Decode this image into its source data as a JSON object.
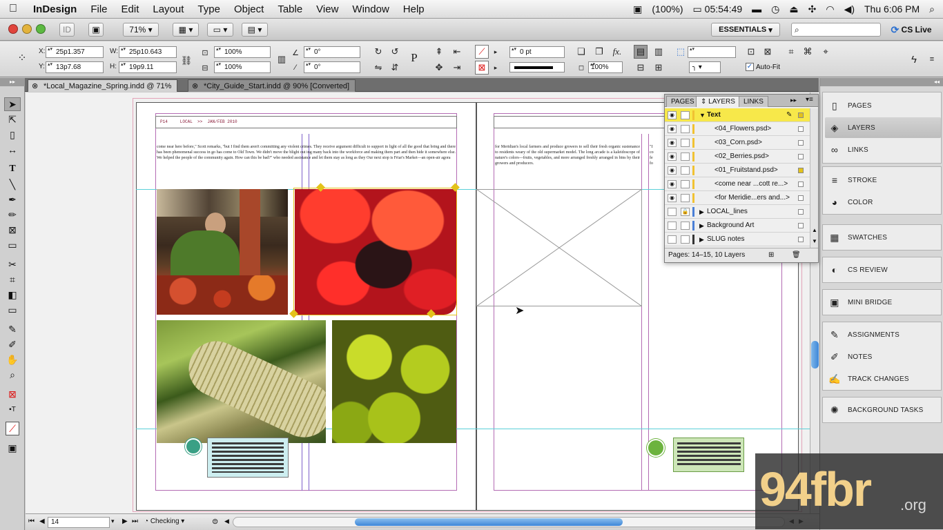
{
  "menubar": {
    "app": "InDesign",
    "menus": [
      "File",
      "Edit",
      "Layout",
      "Type",
      "Object",
      "Table",
      "View",
      "Window",
      "Help"
    ],
    "battery": "(100%)",
    "clock_timer": "05:54:49",
    "datetime": "Thu 6:06 PM"
  },
  "appbar": {
    "zoom": "71%",
    "workspace": "ESSENTIALS",
    "search_placeholder": "",
    "cslive": "CS Live"
  },
  "control": {
    "x_label": "X:",
    "x_value": "25p1.357",
    "y_label": "Y:",
    "y_value": "13p7.68",
    "w_label": "W:",
    "w_value": "25p10.643",
    "h_label": "H:",
    "h_value": "19p9.11",
    "scale_x": "100%",
    "scale_y": "100%",
    "rotate": "0°",
    "shear": "0°",
    "stroke_weight": "0 pt",
    "opacity": "100%",
    "autofit_label": "Auto-Fit"
  },
  "tabs": [
    {
      "label": "*Local_Magazine_Spring.indd @ 71%",
      "active": true
    },
    {
      "label": "*City_Guide_Start.indd @ 90% [Converted]",
      "active": false
    }
  ],
  "layers_panel": {
    "tabs": [
      "PAGES",
      "LAYERS",
      "LINKS"
    ],
    "active_tab": "LAYERS",
    "rows": [
      {
        "name": "Text",
        "level": 0,
        "expanded": true,
        "selected": true,
        "color": "#f1c232"
      },
      {
        "name": "<04_Flowers.psd>",
        "level": 1,
        "color": "#f1c232"
      },
      {
        "name": "<03_Corn.psd>",
        "level": 1,
        "color": "#f1c232"
      },
      {
        "name": "<02_Berries.psd>",
        "level": 1,
        "color": "#f1c232"
      },
      {
        "name": "<01_Fruitstand.psd>",
        "level": 1,
        "color": "#f1c232"
      },
      {
        "name": "<come near ...cott re...>",
        "level": 1,
        "color": "#f1c232"
      },
      {
        "name": "<for Meridie...ers and...>",
        "level": 1,
        "color": "#f1c232"
      },
      {
        "name": "LOCAL_lines",
        "level": 0,
        "locked": true,
        "color": "#4a7fd6"
      },
      {
        "name": "Background Art",
        "level": 0,
        "color": "#4a7fd6"
      },
      {
        "name": "SLUG notes",
        "level": 0,
        "color": "#333333"
      }
    ],
    "footer": "Pages: 14–15, 10 Layers"
  },
  "dock": [
    {
      "group": 1,
      "items": [
        {
          "label": "PAGES",
          "icon": "pages-icon",
          "glyph": "▯"
        },
        {
          "label": "LAYERS",
          "icon": "layers-icon",
          "glyph": "◈",
          "selected": true
        },
        {
          "label": "LINKS",
          "icon": "links-icon",
          "glyph": "∞"
        }
      ]
    },
    {
      "group": 2,
      "items": [
        {
          "label": "STROKE",
          "icon": "stroke-icon",
          "glyph": "≡"
        },
        {
          "label": "COLOR",
          "icon": "color-icon",
          "glyph": "◕"
        }
      ]
    },
    {
      "group": 3,
      "items": [
        {
          "label": "SWATCHES",
          "icon": "swatches-icon",
          "glyph": "▦"
        }
      ]
    },
    {
      "group": 4,
      "items": [
        {
          "label": "CS REVIEW",
          "icon": "cs-review-icon",
          "glyph": "◐"
        }
      ]
    },
    {
      "group": 5,
      "items": [
        {
          "label": "MINI BRIDGE",
          "icon": "mini-bridge-icon",
          "glyph": "▣"
        }
      ]
    },
    {
      "group": 6,
      "items": [
        {
          "label": "ASSIGNMENTS",
          "icon": "assignments-icon",
          "glyph": "✎"
        },
        {
          "label": "NOTES",
          "icon": "notes-icon",
          "glyph": "✐"
        },
        {
          "label": "TRACK CHANGES",
          "icon": "track-changes-icon",
          "glyph": "✍"
        }
      ]
    },
    {
      "group": 7,
      "items": [
        {
          "label": "BACKGROUND TASKS",
          "icon": "background-tasks-icon",
          "glyph": "✺"
        }
      ]
    }
  ],
  "document": {
    "folio": "P14     LOCAL  >>  JAN/FEB 2010",
    "body_left": "come near here before,\" Scott remarks, \"but I find them aren't committing any violent crimes. They receive argument difficult to support in light of all the good that bring and there has been phenomenal success in go has come to Old Town. We didn't move the blight out ing many back into the workforce and making them part and then hide it somewhere else. We helped the people of the community again. How can this be bad?\" who needed assistance and let them stay as long as they   Our next stop is Friar's Market—an open-air agora",
    "body_right": "for Meridian's local farmers and produce growers to sell their fresh organic sustenance to residents weary of the old supermarket model. The long arcade is a kaleidoscope of nature's colors—fruits, vegetables, and more arranged freshly arranged in bins by their growers and producers."
  },
  "statusbar": {
    "page": "14",
    "preflight": "Checking"
  },
  "watermark": {
    "main": "94fbr",
    "suffix": ".org"
  }
}
